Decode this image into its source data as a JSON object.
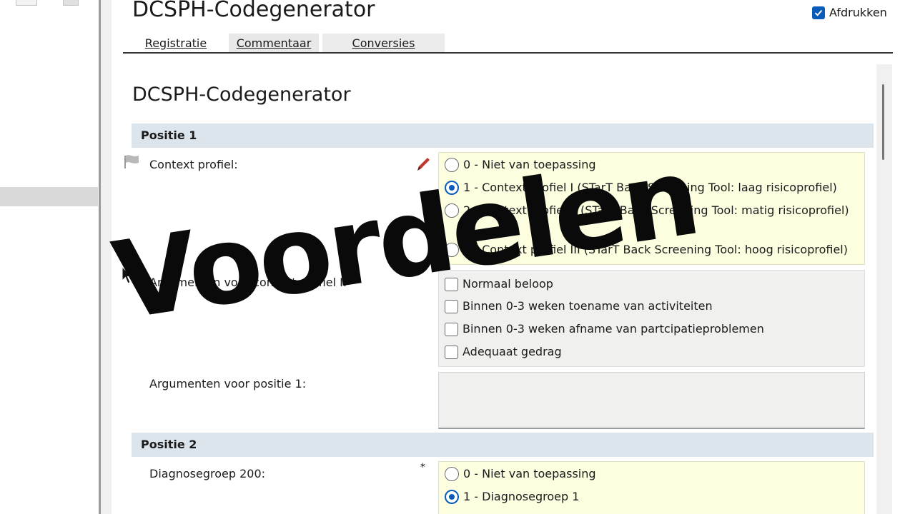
{
  "app": {
    "title": "DCSPH-Codegenerator",
    "print_label": "Afdrukken",
    "print_checked": true
  },
  "tabs": [
    {
      "label": "Registratie"
    },
    {
      "label": "Commentaar"
    },
    {
      "label": "Conversies"
    }
  ],
  "form": {
    "title": "DCSPH-Codegenerator",
    "positie1": {
      "header": "Positie 1",
      "context_label": "Context profiel:",
      "context_options": [
        {
          "label": "0 - Niet van toepassing",
          "selected": false
        },
        {
          "label": "1 - Context profiel I (STarT Back Screening Tool: laag risicoprofiel)",
          "selected": true
        },
        {
          "label": "2 - Context profiel II (STarT Back Screening Tool: matig risicoprofiel)",
          "selected": false
        },
        {
          "label": "3 - Context profiel III (STarT Back Screening Tool: hoog risicoprofiel)",
          "selected": false
        }
      ],
      "arguments_context_label": "Argumenten voor context profiel I:",
      "argument_options": [
        {
          "label": "Normaal beloop"
        },
        {
          "label": "Binnen 0-3 weken toename van activiteiten"
        },
        {
          "label": "Binnen 0-3 weken afname van partcipatieproblemen"
        },
        {
          "label": "Adequaat gedrag"
        }
      ],
      "arguments_position_label": "Argumenten voor positie 1:"
    },
    "positie2": {
      "header": "Positie 2",
      "diagnose_label": "Diagnosegroep 200:",
      "required_mark": "*",
      "diagnose_options": [
        {
          "label": "0 - Niet van toepassing",
          "selected": false
        },
        {
          "label": "1 - Diagnosegroep 1",
          "selected": true
        }
      ]
    }
  },
  "overlay_text": "Voordelen",
  "icons": [
    "flag-icon",
    "pencil-icon",
    "checkmark-icon",
    "mouse-cursor-icon"
  ],
  "colors": {
    "accent": "#0a5cb8",
    "section_header": "#dde5ec",
    "option_box_yellow": "#fdfde0",
    "option_box_grey": "#f0f0ee",
    "pencil": "#c0392b"
  }
}
